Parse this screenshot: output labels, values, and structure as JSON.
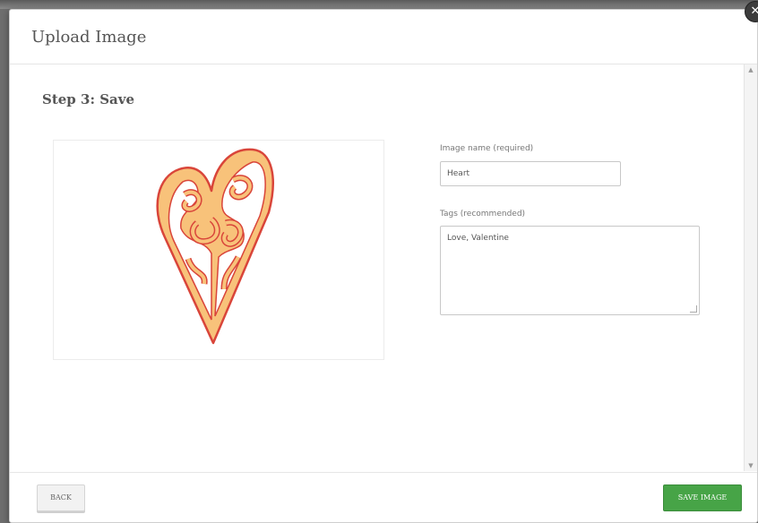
{
  "modal": {
    "title": "Upload Image",
    "close_icon": "close-icon"
  },
  "step": {
    "title": "Step 3: Save"
  },
  "preview": {
    "icon": "heart-image",
    "fill_color": "#f8c27a",
    "stroke_color": "#d9453a"
  },
  "form": {
    "name_label": "Image name (required)",
    "name_value": "Heart",
    "tags_label": "Tags (recommended)",
    "tags_value": "Love, Valentine"
  },
  "footer": {
    "back_label": "BACK",
    "save_label": "SAVE IMAGE",
    "save_color": "#47a447"
  }
}
